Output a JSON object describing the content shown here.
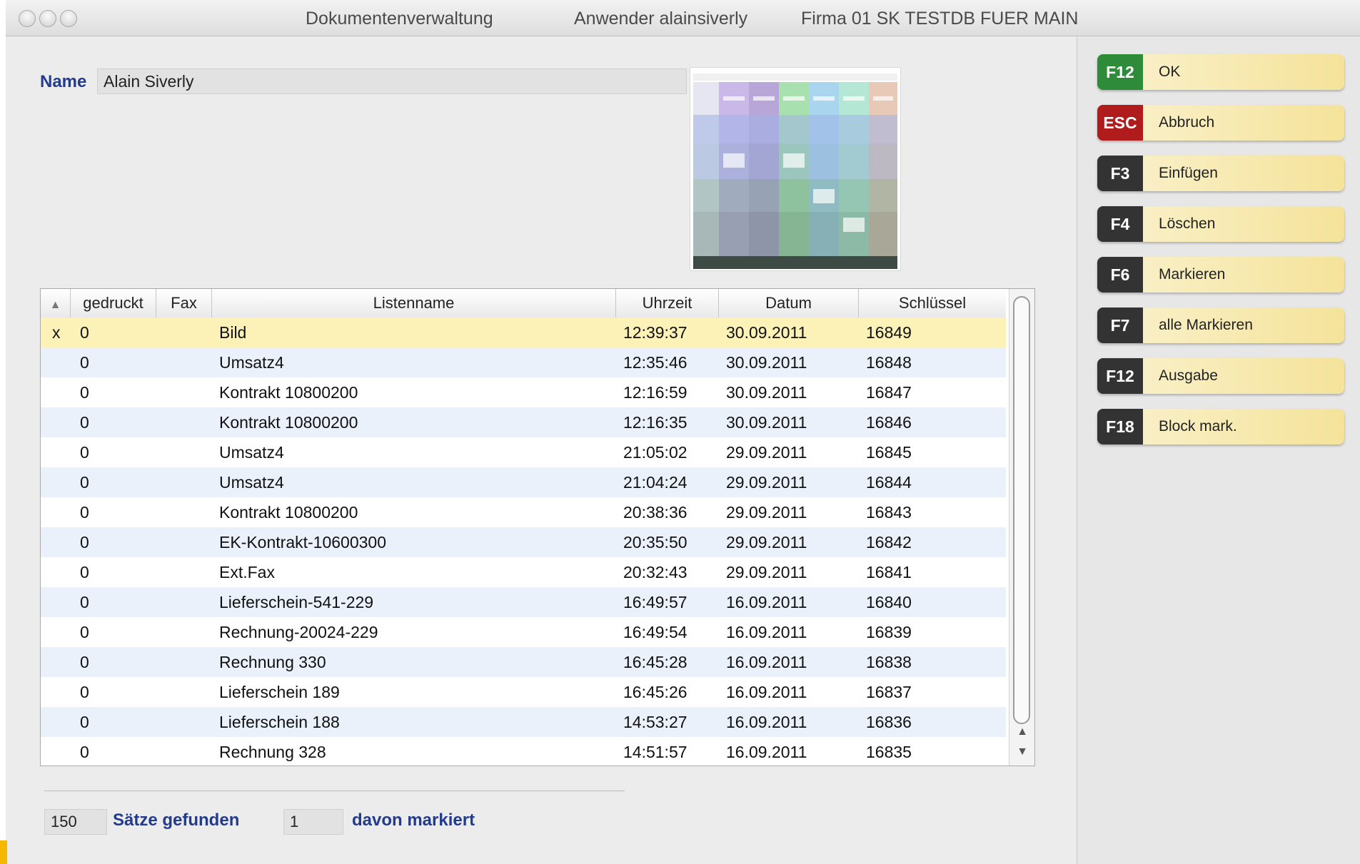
{
  "window": {
    "title": "Dokumentenverwaltung",
    "user": "Anwender alainsiverly",
    "company": "Firma 01 SK TESTDB FUER MAIN"
  },
  "form": {
    "name_label": "Name",
    "name_value": "Alain Siverly"
  },
  "table": {
    "columns": [
      "",
      "gedruckt",
      "Fax",
      "Listenname",
      "Uhrzeit",
      "Datum",
      "Schlüssel"
    ],
    "rows": [
      {
        "mark": "x",
        "gedruckt": "0",
        "fax": "",
        "listenname": "Bild",
        "uhrzeit": "12:39:37",
        "datum": "30.09.2011",
        "schluessel": "16849"
      },
      {
        "mark": "",
        "gedruckt": "0",
        "fax": "",
        "listenname": "Umsatz4",
        "uhrzeit": "12:35:46",
        "datum": "30.09.2011",
        "schluessel": "16848"
      },
      {
        "mark": "",
        "gedruckt": "0",
        "fax": "",
        "listenname": "Kontrakt 10800200",
        "uhrzeit": "12:16:59",
        "datum": "30.09.2011",
        "schluessel": "16847"
      },
      {
        "mark": "",
        "gedruckt": "0",
        "fax": "",
        "listenname": "Kontrakt 10800200",
        "uhrzeit": "12:16:35",
        "datum": "30.09.2011",
        "schluessel": "16846"
      },
      {
        "mark": "",
        "gedruckt": "0",
        "fax": "",
        "listenname": "Umsatz4",
        "uhrzeit": "21:05:02",
        "datum": "29.09.2011",
        "schluessel": "16845"
      },
      {
        "mark": "",
        "gedruckt": "0",
        "fax": "",
        "listenname": "Umsatz4",
        "uhrzeit": "21:04:24",
        "datum": "29.09.2011",
        "schluessel": "16844"
      },
      {
        "mark": "",
        "gedruckt": "0",
        "fax": "",
        "listenname": "Kontrakt 10800200",
        "uhrzeit": "20:38:36",
        "datum": "29.09.2011",
        "schluessel": "16843"
      },
      {
        "mark": "",
        "gedruckt": "0",
        "fax": "",
        "listenname": "EK-Kontrakt-10600300",
        "uhrzeit": "20:35:50",
        "datum": "29.09.2011",
        "schluessel": "16842"
      },
      {
        "mark": "",
        "gedruckt": "0",
        "fax": "",
        "listenname": "Ext.Fax",
        "uhrzeit": "20:32:43",
        "datum": "29.09.2011",
        "schluessel": "16841"
      },
      {
        "mark": "",
        "gedruckt": "0",
        "fax": "",
        "listenname": "Lieferschein-541-229",
        "uhrzeit": "16:49:57",
        "datum": "16.09.2011",
        "schluessel": "16840"
      },
      {
        "mark": "",
        "gedruckt": "0",
        "fax": "",
        "listenname": "Rechnung-20024-229",
        "uhrzeit": "16:49:54",
        "datum": "16.09.2011",
        "schluessel": "16839"
      },
      {
        "mark": "",
        "gedruckt": "0",
        "fax": "",
        "listenname": "Rechnung 330",
        "uhrzeit": "16:45:28",
        "datum": "16.09.2011",
        "schluessel": "16838"
      },
      {
        "mark": "",
        "gedruckt": "0",
        "fax": "",
        "listenname": "Lieferschein 189",
        "uhrzeit": "16:45:26",
        "datum": "16.09.2011",
        "schluessel": "16837"
      },
      {
        "mark": "",
        "gedruckt": "0",
        "fax": "",
        "listenname": "Lieferschein 188",
        "uhrzeit": "14:53:27",
        "datum": "16.09.2011",
        "schluessel": "16836"
      },
      {
        "mark": "",
        "gedruckt": "0",
        "fax": "",
        "listenname": "Rechnung 328",
        "uhrzeit": "14:51:57",
        "datum": "16.09.2011",
        "schluessel": "16835"
      }
    ]
  },
  "footer": {
    "count_value": "150",
    "count_label": "Sätze gefunden",
    "marked_value": "1",
    "marked_label": "davon markiert"
  },
  "buttons": [
    {
      "key": "F12",
      "label": "OK",
      "color": "#2e8b3a"
    },
    {
      "key": "ESC",
      "label": "Abbruch",
      "color": "#b01c1c"
    },
    {
      "key": "F3",
      "label": "Einfügen",
      "color": "#333333"
    },
    {
      "key": "F4",
      "label": "Löschen",
      "color": "#333333"
    },
    {
      "key": "F6",
      "label": "Markieren",
      "color": "#333333"
    },
    {
      "key": "F7",
      "label": "alle Markieren",
      "color": "#333333"
    },
    {
      "key": "F12",
      "label": "Ausgabe",
      "color": "#333333"
    },
    {
      "key": "F18",
      "label": "Block mark.",
      "color": "#333333"
    }
  ],
  "icons": {
    "sort": "sort-asc-icon",
    "scroll_up": "scroll-up-arrow-icon",
    "scroll_down": "scroll-down-arrow-icon"
  }
}
